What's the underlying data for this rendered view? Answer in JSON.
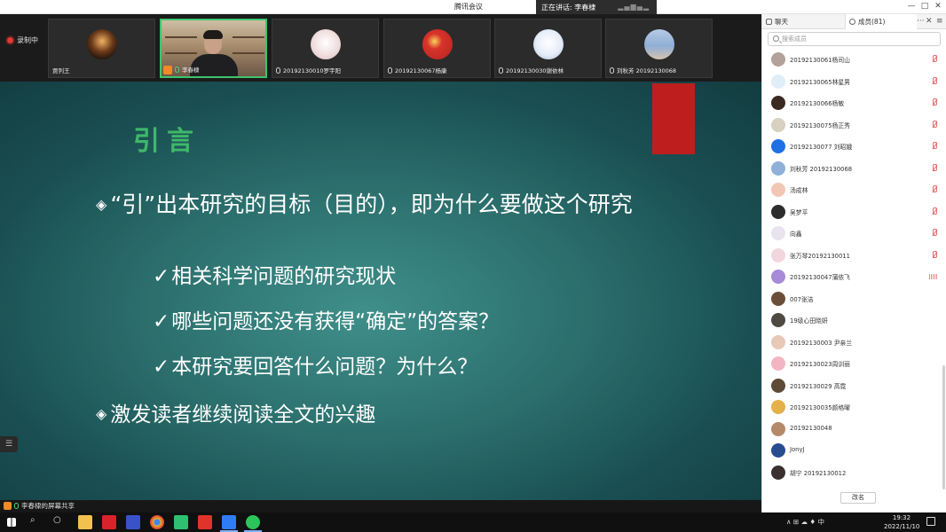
{
  "window": {
    "title": "腾讯会议",
    "speaking_label": "正在讲话: 李春棣",
    "controls": [
      "—",
      "□",
      "✕"
    ]
  },
  "recording": {
    "label": "录制中"
  },
  "video_tiles": [
    {
      "name": "贾列王",
      "style": "avatar",
      "color": "#2a1f16"
    },
    {
      "name": "李春棣",
      "style": "camera",
      "host": true
    },
    {
      "name": "20192130010罗宇阳",
      "style": "avatar",
      "color": "#f3e7e7"
    },
    {
      "name": "20192130067杨康",
      "style": "avatar",
      "color": "#c8352b"
    },
    {
      "name": "20192130030谢依林",
      "style": "avatar",
      "color": "#e9eef6"
    },
    {
      "name": "刘秋芳 20192130068",
      "style": "avatar",
      "color": "#8fb0d8"
    }
  ],
  "slide": {
    "title": "引言",
    "bullet1": "“引”出本研究的目标（目的），即为什么要做这个研究",
    "sub_items": [
      "相关科学问题的研究现状",
      "哪些问题还没有获得“确定”的答案？",
      "本研究要回答什么问题？为什么？"
    ],
    "bullet2": "激发读者继续阅读全文的兴趣",
    "bullet_glyph": "◈",
    "check_glyph": "✓"
  },
  "share_bar": {
    "label": "李春棣的屏幕共享"
  },
  "panel": {
    "tab_chat": "聊天",
    "tab_members": "成员(81)",
    "more": "···",
    "close": "✕",
    "menu": "≡",
    "search_placeholder": "搜索成员",
    "sort_label": "改名",
    "members": [
      {
        "name": "20192130061杨司山",
        "color": "#b3a19a",
        "status": "muted"
      },
      {
        "name": "20192130065林星男",
        "color": "#dfeef7",
        "status": "muted"
      },
      {
        "name": "20192130066杨敏",
        "color": "#3b2a22",
        "status": "muted"
      },
      {
        "name": "20192130075杨正秀",
        "color": "#d8d0c0",
        "status": "muted"
      },
      {
        "name": "20192130077 刘昭娥",
        "color": "#1f6fe5",
        "status": "muted"
      },
      {
        "name": "刘秋芳 20192130068",
        "color": "#8fb0d8",
        "status": "muted"
      },
      {
        "name": "汤成林",
        "color": "#f2c7b5",
        "status": "muted"
      },
      {
        "name": "吴梦平",
        "color": "#2d2d2d",
        "status": "muted"
      },
      {
        "name": "向鑫",
        "color": "#e9e2ef",
        "status": "muted"
      },
      {
        "name": "张万琴20192130011",
        "color": "#f1d7dd",
        "status": "muted"
      },
      {
        "name": "20192130047蒲依飞",
        "color": "#a78bd8",
        "status": "speaking"
      },
      {
        "name": "007张洁",
        "color": "#6b4e3a",
        "status": "none"
      },
      {
        "name": "19级心田晓妍",
        "color": "#4f4a42",
        "status": "none"
      },
      {
        "name": "20192130003 尹亲兰",
        "color": "#e7c9b7",
        "status": "none"
      },
      {
        "name": "20192130023周训丽",
        "color": "#f3b5c2",
        "status": "none"
      },
      {
        "name": "20192130029 高霓",
        "color": "#5e4a35",
        "status": "none"
      },
      {
        "name": "20192130035颜格曜",
        "color": "#e3b04a",
        "status": "none"
      },
      {
        "name": "20192130048",
        "color": "#b48a6a",
        "status": "none"
      },
      {
        "name": "JonyJ",
        "color": "#284d8f",
        "status": "none"
      },
      {
        "name": "胡宁 20192130012",
        "color": "#3a3030",
        "status": "none"
      }
    ]
  },
  "taskbar": {
    "search_glyph": "⌕",
    "taskview_glyph": "○",
    "apps": [
      {
        "name": "file-explorer",
        "color": "#f2c14e"
      },
      {
        "name": "red-app",
        "color": "#d8232a"
      },
      {
        "name": "en-app",
        "color": "#3a52c9"
      },
      {
        "name": "chrome",
        "color": "#e8b32c"
      },
      {
        "name": "xmind",
        "color": "#2fbf71"
      },
      {
        "name": "wps",
        "color": "#e0342b"
      },
      {
        "name": "tencent-meeting",
        "color": "#2f7df6"
      },
      {
        "name": "wechat",
        "color": "#2ec45c"
      }
    ],
    "tray_text": "∧ ⊞ ☁ ♦ 中",
    "time": "19:32",
    "date": "2022/11/10",
    "notification_count": "1"
  }
}
